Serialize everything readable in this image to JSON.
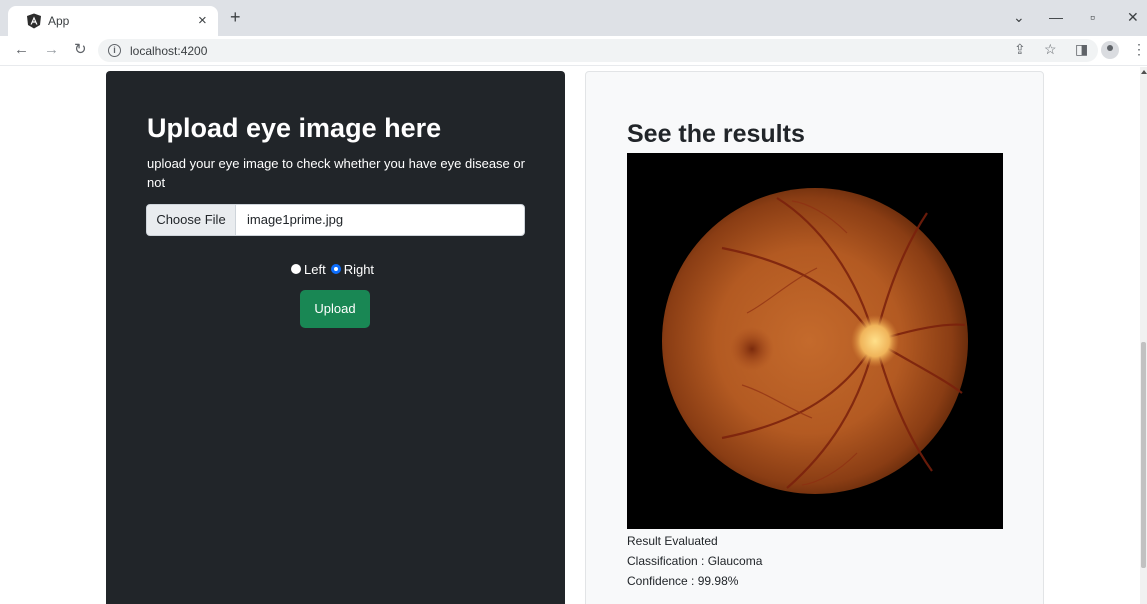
{
  "browser": {
    "tab_title": "App",
    "url": "localhost:4200",
    "new_tab_glyph": "+",
    "close_glyph": "×"
  },
  "upload": {
    "title": "Upload eye image here",
    "description": "upload your eye image to check whether you have eye disease or not",
    "choose_file_label": "Choose File",
    "file_name": "image1prime.jpg",
    "radio_left_label": "Left",
    "radio_right_label": "Right",
    "selected_eye": "Right",
    "upload_button": "Upload"
  },
  "results": {
    "title": "See the results",
    "status": "Result Evaluated",
    "classification": "Classification : Glaucoma",
    "confidence": "Confidence : 99.98%"
  },
  "colors": {
    "upload_panel": "#212529",
    "results_panel": "#f8f9fa",
    "upload_button": "#198754",
    "radio_selected": "#0d6efd"
  },
  "icons": {
    "favicon": "angular-logo-icon",
    "back": "arrow-left-icon",
    "forward": "arrow-right-icon",
    "reload": "reload-icon",
    "site_info": "info-icon",
    "share": "share-icon",
    "bookmark": "star-icon",
    "side_panel": "side-panel-icon",
    "profile": "profile-icon",
    "menu": "kebab-menu-icon"
  }
}
